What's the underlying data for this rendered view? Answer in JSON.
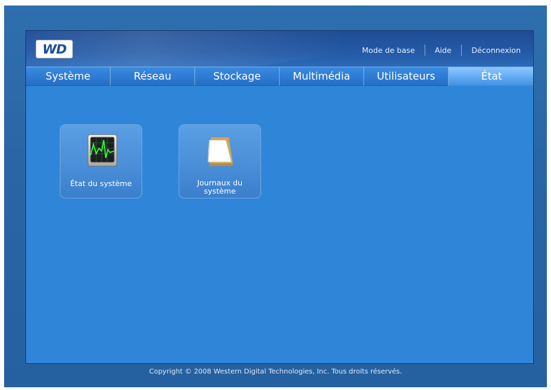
{
  "header": {
    "logo_text": "WD",
    "links": {
      "basic_mode": "Mode de base",
      "help": "Aide",
      "logout": "Déconnexion"
    }
  },
  "tabs": [
    {
      "label": "Système",
      "active": false
    },
    {
      "label": "Réseau",
      "active": false
    },
    {
      "label": "Stockage",
      "active": false
    },
    {
      "label": "Multimédia",
      "active": false
    },
    {
      "label": "Utilisateurs",
      "active": false
    },
    {
      "label": "État",
      "active": true
    }
  ],
  "tiles": [
    {
      "label": "État du système",
      "icon": "monitor-graph-icon"
    },
    {
      "label": "Journaux du système",
      "icon": "notepad-icon"
    }
  ],
  "footer": {
    "copyright": "Copyright © 2008 Western Digital Technologies, Inc. Tous droits réservés."
  },
  "colors": {
    "background": "#2a66a5",
    "content": "#2f86d8",
    "active_tab": "#69b0f6",
    "header": "#245aa6"
  }
}
